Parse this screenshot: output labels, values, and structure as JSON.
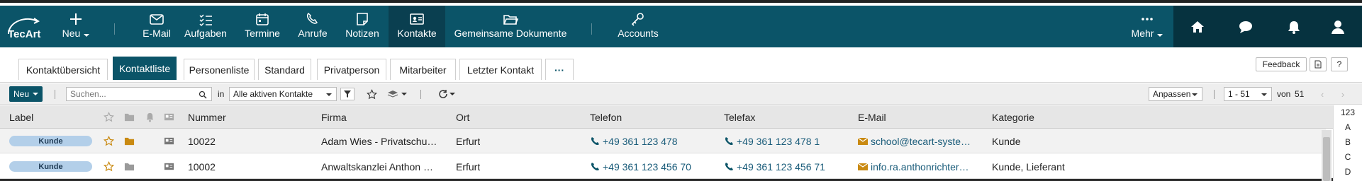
{
  "app": {
    "logo_text": "TecArt"
  },
  "nav": {
    "new_label": "Neu",
    "items": [
      {
        "label": "E-Mail",
        "icon": "mail-icon"
      },
      {
        "label": "Aufgaben",
        "icon": "tasks-icon"
      },
      {
        "label": "Termine",
        "icon": "calendar-icon"
      },
      {
        "label": "Anrufe",
        "icon": "phone-icon"
      },
      {
        "label": "Notizen",
        "icon": "note-icon"
      },
      {
        "label": "Kontakte",
        "icon": "contact-card-icon",
        "active": true
      },
      {
        "label": "Gemeinsame Dokumente",
        "icon": "folder-open-icon"
      },
      {
        "label": "Accounts",
        "icon": "key-icon"
      }
    ],
    "more_label": "Mehr"
  },
  "tabs": {
    "items": [
      "Kontaktübersicht",
      "Kontaktliste",
      "Personenliste",
      "Standard",
      "Privatperson",
      "Mitarbeiter",
      "Letzter Kontakt"
    ],
    "active_index": 1,
    "more_label": "···",
    "feedback_label": "Feedback",
    "help_label": "?"
  },
  "toolbar": {
    "new_label": "Neu",
    "search_placeholder": "Suchen...",
    "in_label": "in",
    "filter_value": "Alle aktiven Kontakte",
    "adjust_label": "Anpassen",
    "range_value": "1 - 51",
    "of_label": "von",
    "total": "51"
  },
  "table": {
    "columns": [
      "Label",
      "Nummer",
      "Firma",
      "Ort",
      "Telefon",
      "Telefax",
      "E-Mail",
      "Kategorie"
    ],
    "rows": [
      {
        "label": "Kunde",
        "nummer": "10022",
        "firma": "Adam Wies - Privatschu…",
        "ort": "Erfurt",
        "telefon": "+49 361 123 478",
        "telefax": "+49 361 123 478 1",
        "email": "school@tecart-syste…",
        "kategorie": "Kunde",
        "folder_color": "#c98a12"
      },
      {
        "label": "Kunde",
        "nummer": "10002",
        "firma": "Anwaltskanzlei Anthon …",
        "ort": "Erfurt",
        "telefon": "+49 361 123 456 70",
        "telefax": "+49 361 123 456 71",
        "email": "info.ra.anthonrichter…",
        "kategorie": "Kunde, Lieferant",
        "folder_color": "#9a9a9a"
      }
    ]
  },
  "alphabet": [
    "123",
    "A",
    "B",
    "C",
    "D"
  ],
  "colors": {
    "primary": "#0b5468",
    "primary_dark": "#06323f",
    "accent": "#c98a12",
    "badge": "#b3cfe9"
  }
}
